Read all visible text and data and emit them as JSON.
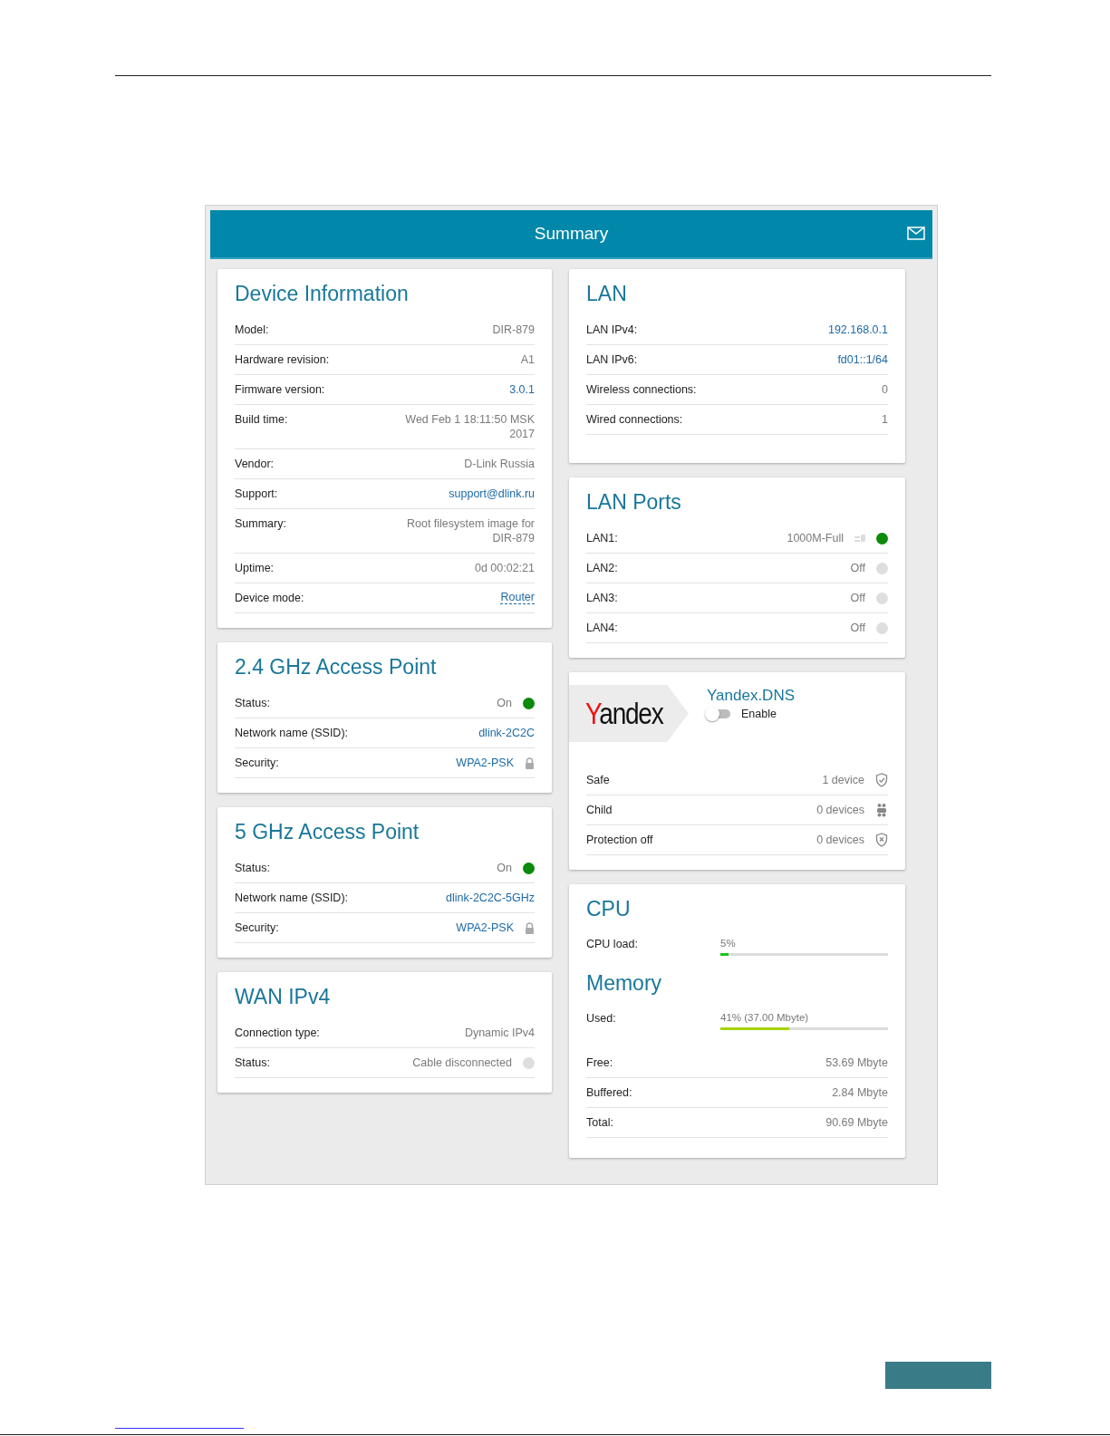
{
  "screen": {
    "title": "Summary"
  },
  "left_cards": [
    {
      "title": "Device Information",
      "rows": [
        {
          "label": "Model:",
          "value": "DIR-879",
          "kind": "text"
        },
        {
          "label": "Hardware revision:",
          "value": "A1",
          "kind": "text"
        },
        {
          "label": "Firmware version:",
          "value": "3.0.1",
          "kind": "link"
        },
        {
          "label": "Build time:",
          "value": "Wed Feb 1 18:11:50 MSK 2017",
          "kind": "text"
        },
        {
          "label": "Vendor:",
          "value": "D-Link Russia",
          "kind": "text"
        },
        {
          "label": "Support:",
          "value": "support@dlink.ru",
          "kind": "link"
        },
        {
          "label": "Summary:",
          "value": "Root filesystem image for DIR-879",
          "kind": "text"
        },
        {
          "label": "Uptime:",
          "value": "0d 00:02:21",
          "kind": "text"
        },
        {
          "label": "Device mode:",
          "value": "Router",
          "kind": "mode"
        }
      ]
    },
    {
      "title": "2.4 GHz Access Point",
      "rows": [
        {
          "label": "Status:",
          "value": "On",
          "kind": "status",
          "on": true
        },
        {
          "label": "Network name (SSID):",
          "value": "dlink-2C2C",
          "kind": "link"
        },
        {
          "label": "Security:",
          "value": "WPA2-PSK",
          "kind": "secure"
        }
      ]
    },
    {
      "title": "5 GHz Access Point",
      "rows": [
        {
          "label": "Status:",
          "value": "On",
          "kind": "status",
          "on": true
        },
        {
          "label": "Network name (SSID):",
          "value": "dlink-2C2C-5GHz",
          "kind": "link"
        },
        {
          "label": "Security:",
          "value": "WPA2-PSK",
          "kind": "secure"
        }
      ]
    },
    {
      "title": "WAN IPv4",
      "rows": [
        {
          "label": "Connection type:",
          "value": "Dynamic IPv4",
          "kind": "text"
        },
        {
          "label": "Status:",
          "value": "Cable disconnected",
          "kind": "status",
          "on": false
        }
      ]
    }
  ],
  "lan": {
    "title": "LAN",
    "rows": [
      {
        "label": "LAN IPv4:",
        "value": "192.168.0.1",
        "kind": "link"
      },
      {
        "label": "LAN IPv6:",
        "value": "fd01::1/64",
        "kind": "link"
      },
      {
        "label": "Wireless connections:",
        "value": "0",
        "kind": "text"
      },
      {
        "label": "Wired connections:",
        "value": "1",
        "kind": "text"
      }
    ]
  },
  "lan_ports": {
    "title": "LAN Ports",
    "rows": [
      {
        "label": "LAN1:",
        "value": "1000M-Full",
        "kind": "port",
        "on": true
      },
      {
        "label": "LAN2:",
        "value": "Off",
        "kind": "status",
        "on": false
      },
      {
        "label": "LAN3:",
        "value": "Off",
        "kind": "status",
        "on": false
      },
      {
        "label": "LAN4:",
        "value": "Off",
        "kind": "status",
        "on": false
      }
    ]
  },
  "yandex_dns": {
    "logo": "Yandex",
    "title": "Yandex.DNS",
    "toggle": {
      "label": "Enable",
      "on": false
    },
    "rows": [
      {
        "label": "Safe",
        "value": "1 device",
        "kind": "safe"
      },
      {
        "label": "Child",
        "value": "0 devices",
        "kind": "child"
      },
      {
        "label": "Protection off",
        "value": "0 devices",
        "kind": "off"
      }
    ]
  },
  "cpu": {
    "title": "CPU",
    "label": "CPU load:",
    "reading": "5%",
    "level": 0.05
  },
  "memory": {
    "title": "Memory",
    "label": "Used:",
    "reading": "41% (37.00 Mbyte)",
    "level": 0.41,
    "rows": [
      {
        "label": "Free:",
        "value": "53.69 Mbyte",
        "kind": "text"
      },
      {
        "label": "Buffered:",
        "value": "2.84 Mbyte",
        "kind": "text"
      },
      {
        "label": "Total:",
        "value": "90.69 Mbyte",
        "kind": "text"
      }
    ]
  }
}
